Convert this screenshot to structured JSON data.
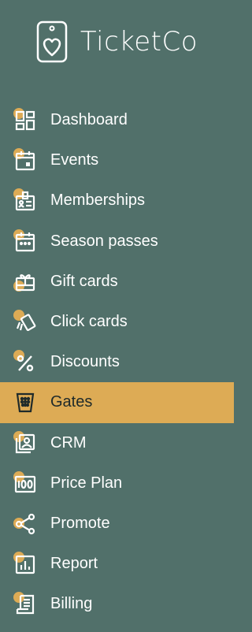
{
  "brand": {
    "name": "TicketCo"
  },
  "colors": {
    "sidebar_bg": "#51706a",
    "accent": "#ddab55",
    "text": "#ffffff",
    "active_text": "#1f2a2a"
  },
  "nav": {
    "items": [
      {
        "label": "Dashboard",
        "icon": "dashboard-icon"
      },
      {
        "label": "Events",
        "icon": "calendar-icon"
      },
      {
        "label": "Memberships",
        "icon": "membership-card-icon"
      },
      {
        "label": "Season passes",
        "icon": "calendar-grid-icon"
      },
      {
        "label": "Gift cards",
        "icon": "gift-card-icon"
      },
      {
        "label": "Click cards",
        "icon": "click-card-icon"
      },
      {
        "label": "Discounts",
        "icon": "percent-icon"
      },
      {
        "label": "Gates",
        "icon": "scanner-icon",
        "active": true
      },
      {
        "label": "CRM",
        "icon": "contact-icon"
      },
      {
        "label": "Price Plan",
        "icon": "price-plan-icon"
      },
      {
        "label": "Promote",
        "icon": "share-icon"
      },
      {
        "label": "Report",
        "icon": "report-icon"
      },
      {
        "label": "Billing",
        "icon": "billing-icon"
      }
    ]
  }
}
